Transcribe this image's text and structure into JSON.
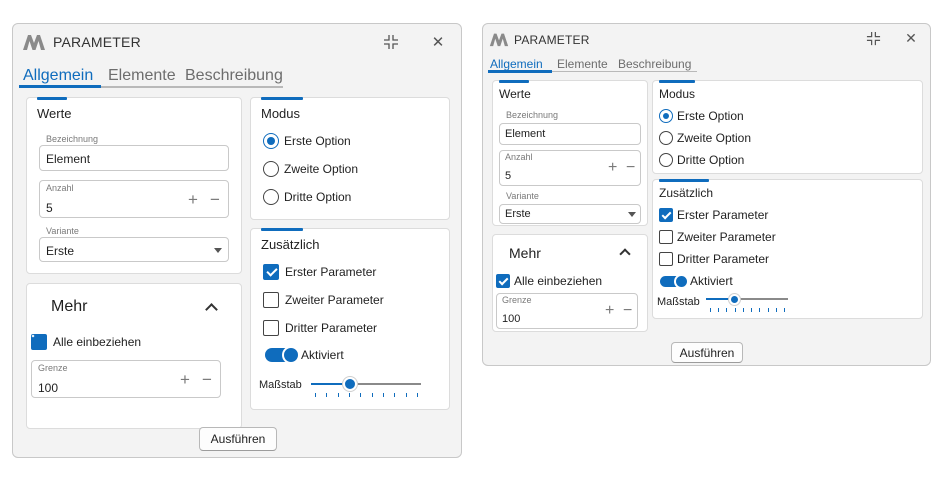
{
  "title": "PARAMETER",
  "tabs": [
    {
      "label": "Allgemein",
      "active": true
    },
    {
      "label": "Elemente",
      "active": false
    },
    {
      "label": "Beschreibung",
      "active": false
    }
  ],
  "werte": {
    "title": "Werte",
    "bezeichnung": {
      "label": "Bezeichnung",
      "value": "Element"
    },
    "anzahl": {
      "label": "Anzahl",
      "value": "5"
    },
    "variante": {
      "label": "Variante",
      "value": "Erste"
    }
  },
  "mehr": {
    "title": "Mehr",
    "alle": {
      "label": "Alle einbeziehen",
      "checked": true
    },
    "grenze": {
      "label": "Grenze",
      "value": "100"
    }
  },
  "modus": {
    "title": "Modus",
    "options": [
      {
        "label": "Erste Option",
        "selected": true
      },
      {
        "label": "Zweite Option",
        "selected": false
      },
      {
        "label": "Dritte Option",
        "selected": false
      }
    ]
  },
  "zusaetzlich": {
    "title": "Zusätzlich",
    "checks": [
      {
        "label": "Erster Parameter",
        "checked": true
      },
      {
        "label": "Zweiter Parameter",
        "checked": false
      },
      {
        "label": "Dritter Parameter",
        "checked": false
      }
    ],
    "toggle": {
      "label": "Aktiviert",
      "on": true
    },
    "slider": {
      "label": "Maßstab",
      "value": 0.35,
      "ticks": 10
    }
  },
  "run_label": "Ausführen",
  "glyphs": {
    "plus": "+",
    "minus": "−",
    "close": "✕"
  },
  "colors": {
    "accent": "#0f6cbd",
    "window": "#f3f3f3",
    "card": "#ffffff",
    "logo": "#8a8a8a"
  }
}
